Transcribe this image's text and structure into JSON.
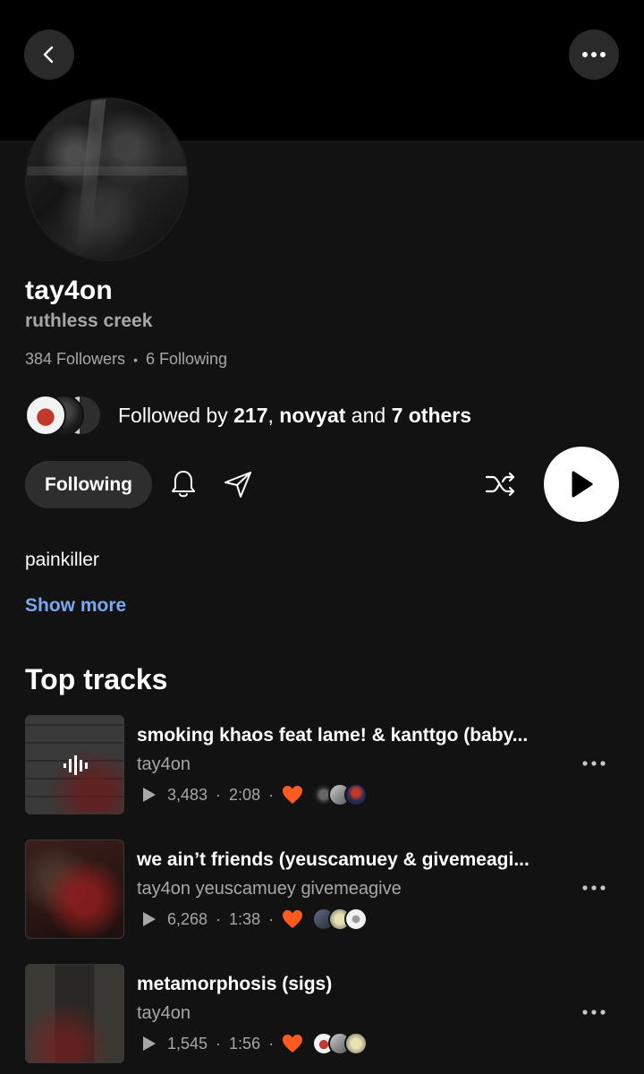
{
  "header": {
    "back_icon": "chevron-left-icon",
    "more_icon": "more-horizontal-icon"
  },
  "profile": {
    "username": "tay4on",
    "location": "ruthless creek",
    "followers": "384 Followers",
    "separator": "•",
    "following": "6 Following",
    "followed_by": {
      "prefix": "Followed by ",
      "first": "217",
      "comma": ", ",
      "second": "novyat",
      "and": " and ",
      "others": "7 others"
    },
    "bio": "painkiller",
    "show_more": "Show more"
  },
  "actions": {
    "following_label": "Following",
    "bell_icon": "bell-icon",
    "share_icon": "send-icon",
    "shuffle_icon": "shuffle-icon",
    "play_icon": "play-icon"
  },
  "top_tracks": {
    "title": "Top tracks",
    "tracks": [
      {
        "title": "smoking khaos feat lame! & kanttgo (baby...",
        "artist": "tay4on",
        "plays": "3,483",
        "duration": "2:08",
        "dot": "·"
      },
      {
        "title": "we ain’t friends (yeuscamuey & givemeagi...",
        "artist": "tay4on yeuscamuey givemeagive",
        "plays": "6,268",
        "duration": "1:38",
        "dot": "·"
      },
      {
        "title": "metamorphosis (sigs)",
        "artist": "tay4on",
        "plays": "1,545",
        "duration": "1:56",
        "dot": "·"
      }
    ]
  },
  "colors": {
    "background": "#121212",
    "header": "#000000",
    "accent_link": "#7aa7f0",
    "heart": "#ff5a1f",
    "muted_text": "#a7a7a7"
  }
}
